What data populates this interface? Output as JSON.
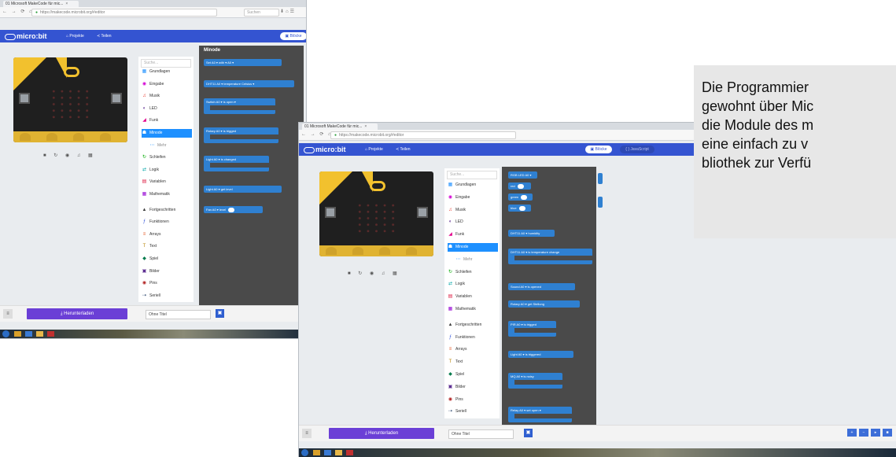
{
  "shot1": {
    "tab_title": "01 Microsoft MakeCode für mic...",
    "nav_glyphs": "← → ⟳ ⌂",
    "url": "https://makecode.microbit.org/#editor",
    "browser_search": "Suchen",
    "header": {
      "logo": "micro:bit",
      "projects": "Projekte",
      "share": "Teilen",
      "blocks_label": "Blöcke",
      "js_label": "JavaScript",
      "ms_label": "Microsoft"
    },
    "search_placeholder": "Suche...",
    "categories": [
      {
        "label": "Grundlagen",
        "color": "#1e90ff",
        "icon": "▦"
      },
      {
        "label": "Eingabe",
        "color": "#d400d4",
        "icon": "◉"
      },
      {
        "label": "Musik",
        "color": "#e63022",
        "icon": "♫"
      },
      {
        "label": "LED",
        "color": "#5c2d91",
        "icon": "◐"
      },
      {
        "label": "Funk",
        "color": "#e3008c",
        "icon": "◢"
      },
      {
        "label": "Minode",
        "color": "#1e90ff",
        "icon": "☗"
      },
      {
        "label": "Mehr",
        "color": "#1e90ff",
        "icon": "⋯"
      },
      {
        "label": "Schleifen",
        "color": "#00aa00",
        "icon": "↻"
      },
      {
        "label": "Logik",
        "color": "#00a4a6",
        "icon": "⇄"
      },
      {
        "label": "Variablen",
        "color": "#dc143c",
        "icon": "▤"
      },
      {
        "label": "Mathematik",
        "color": "#9400d3",
        "icon": "▦"
      },
      {
        "label": "Fortgeschritten",
        "color": "#3c3c3c",
        "icon": "▲"
      },
      {
        "label": "Funktionen",
        "color": "#3455db",
        "icon": "ƒ"
      },
      {
        "label": "Arrays",
        "color": "#e65722",
        "icon": "≡"
      },
      {
        "label": "Text",
        "color": "#b8860b",
        "icon": "T"
      },
      {
        "label": "Spiel",
        "color": "#007a4b",
        "icon": "◆"
      },
      {
        "label": "Bilder",
        "color": "#5c2d91",
        "icon": "▣"
      },
      {
        "label": "Pins",
        "color": "#b22222",
        "icon": "◉"
      },
      {
        "label": "Seriell",
        "color": "#002050",
        "icon": "⇢"
      }
    ],
    "flyout_title": "Minode",
    "blocks": [
      "Set A0 ▾ with ▾ A0 ▾",
      "DHT11 A0 ▾ temperature Celsius ▾",
      "Switch A0 ▾ is open ▾",
      "Rotary A0 ▾ is trigged",
      "Light A0 ▾ is changed",
      "Light A0 ▾ get level",
      "Fan A0 ▾ level"
    ],
    "download_label": "⤓ Herunterladen",
    "filename": "Ohne Titel",
    "save_icon": "🖫"
  },
  "shot2": {
    "tab_title": "01 Microsoft MakeCode für mic...",
    "nav_glyphs": "← → ⟳ ⌂",
    "url": "https://makecode.microbit.org/#editor",
    "header": {
      "logo": "micro:bit",
      "projects": "Projekte",
      "share": "Teilen",
      "blocks_label": "Blöcke",
      "js_label": "JavaScript"
    },
    "search_placeholder": "Suche...",
    "blocks": [
      "RGB LED A0 ▾",
      "red",
      "green",
      "blue",
      "DHT11 A0 ▾ humidity",
      "DHT11 A0 ▾ is temperature change",
      "Sound A0 ▾ is opened",
      "Rotary A0 ▾ get Stellung",
      "PIR A0 ▾ is trigged",
      "Light A0 ▾ is triggered",
      "MQ A0 ▾ is noisy",
      "Relay A0 ▾ set open ▾"
    ],
    "download_label": "⤓ Herunterladen",
    "filename": "Ohne Titel",
    "zoom_labels": [
      "+",
      "−",
      "▸",
      "■"
    ]
  },
  "description_lines": [
    "Die Programmier",
    "gewohnt über Mic",
    "die Module des m",
    "eine einfach zu v",
    "bliothek zur Verfü"
  ]
}
